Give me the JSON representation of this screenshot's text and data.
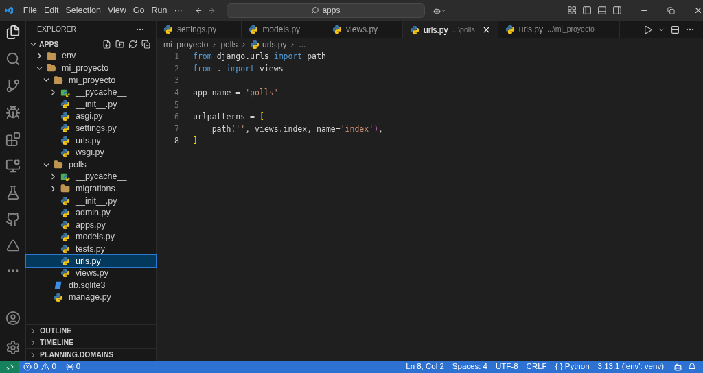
{
  "menu": [
    "File",
    "Edit",
    "Selection",
    "View",
    "Go",
    "Run",
    "···"
  ],
  "command_center": {
    "value": "apps"
  },
  "explorer": {
    "title": "EXPLORER",
    "root": {
      "label": "APPS",
      "expanded": true
    },
    "tree": [
      {
        "label": "env",
        "kind": "folder",
        "expanded": false,
        "selected": false
      },
      {
        "label": "mi_proyecto",
        "kind": "folder",
        "expanded": true,
        "selected": false,
        "children": [
          {
            "label": "mi_proyecto",
            "kind": "folder",
            "expanded": true,
            "selected": false,
            "children": [
              {
                "label": "__pycache__",
                "kind": "pycache",
                "expanded": false,
                "selected": false
              },
              {
                "label": "__init__.py",
                "kind": "python",
                "selected": false
              },
              {
                "label": "asgi.py",
                "kind": "python",
                "selected": false
              },
              {
                "label": "settings.py",
                "kind": "python",
                "selected": false
              },
              {
                "label": "urls.py",
                "kind": "python",
                "selected": false
              },
              {
                "label": "wsgi.py",
                "kind": "python",
                "selected": false
              }
            ]
          },
          {
            "label": "polls",
            "kind": "folder",
            "expanded": true,
            "selected": false,
            "children": [
              {
                "label": "__pycache__",
                "kind": "pycache",
                "expanded": false,
                "selected": false
              },
              {
                "label": "migrations",
                "kind": "folder",
                "expanded": false,
                "selected": false
              },
              {
                "label": "__init__.py",
                "kind": "python",
                "selected": false
              },
              {
                "label": "admin.py",
                "kind": "python",
                "selected": false
              },
              {
                "label": "apps.py",
                "kind": "python",
                "selected": false
              },
              {
                "label": "models.py",
                "kind": "python",
                "selected": false
              },
              {
                "label": "tests.py",
                "kind": "python",
                "selected": false
              },
              {
                "label": "urls.py",
                "kind": "python",
                "selected": true
              },
              {
                "label": "views.py",
                "kind": "python",
                "selected": false
              }
            ]
          },
          {
            "label": "db.sqlite3",
            "kind": "db",
            "selected": false
          },
          {
            "label": "manage.py",
            "kind": "python",
            "selected": false
          }
        ]
      }
    ],
    "sections": [
      "OUTLINE",
      "TIMELINE",
      "PLANNING.DOMAINS"
    ]
  },
  "tabs": [
    {
      "label": "settings.py",
      "selected": false
    },
    {
      "label": "models.py",
      "selected": false
    },
    {
      "label": "views.py",
      "selected": false
    },
    {
      "label": "urls.py",
      "path": "...\\polls",
      "selected": true
    },
    {
      "label": "urls.py",
      "path": "...\\mi_proyecto",
      "selected": false
    }
  ],
  "breadcrumb": [
    "mi_proyecto",
    "polls",
    "urls.py",
    "..."
  ],
  "code": [
    {
      "number": "1",
      "current": false,
      "tokens": [
        {
          "text": "from",
          "kind": "keyword"
        },
        {
          "text": " django.urls ",
          "kind": "plain"
        },
        {
          "text": "import",
          "kind": "keyword"
        },
        {
          "text": " path",
          "kind": "plain"
        }
      ]
    },
    {
      "number": "2",
      "current": false,
      "tokens": [
        {
          "text": "from",
          "kind": "keyword"
        },
        {
          "text": " . ",
          "kind": "plain"
        },
        {
          "text": "import",
          "kind": "keyword"
        },
        {
          "text": " views",
          "kind": "plain"
        }
      ]
    },
    {
      "number": "3",
      "current": false
    },
    {
      "number": "4",
      "current": false,
      "tokens": [
        {
          "text": "app_name = ",
          "kind": "plain"
        },
        {
          "text": "'polls'",
          "kind": "string"
        }
      ]
    },
    {
      "number": "5",
      "current": false
    },
    {
      "number": "6",
      "current": false,
      "tokens": [
        {
          "text": "urlpatterns = ",
          "kind": "plain"
        },
        {
          "text": "[",
          "kind": "bracket"
        }
      ]
    },
    {
      "number": "7",
      "current": false,
      "tokens": [
        {
          "text": "    path",
          "kind": "plain"
        },
        {
          "text": "(",
          "kind": "paren"
        },
        {
          "text": "''",
          "kind": "string"
        },
        {
          "text": ", views.index, name=",
          "kind": "plain"
        },
        {
          "text": "'index'",
          "kind": "string"
        },
        {
          "text": ")",
          "kind": "paren"
        },
        {
          "text": ",",
          "kind": "plain"
        }
      ]
    },
    {
      "number": "8",
      "tokens": [
        {
          "text": "]",
          "kind": "bracket"
        }
      ],
      "current": true
    }
  ],
  "status_bar": {
    "errors": "0",
    "warnings": "0",
    "ports": "0",
    "right": [
      "Ln 8, Col 2",
      "Spaces: 4",
      "UTF-8",
      "CRLF",
      "3.13.1 ('env': venv)"
    ],
    "braces": "{ }",
    "language": "Python"
  }
}
